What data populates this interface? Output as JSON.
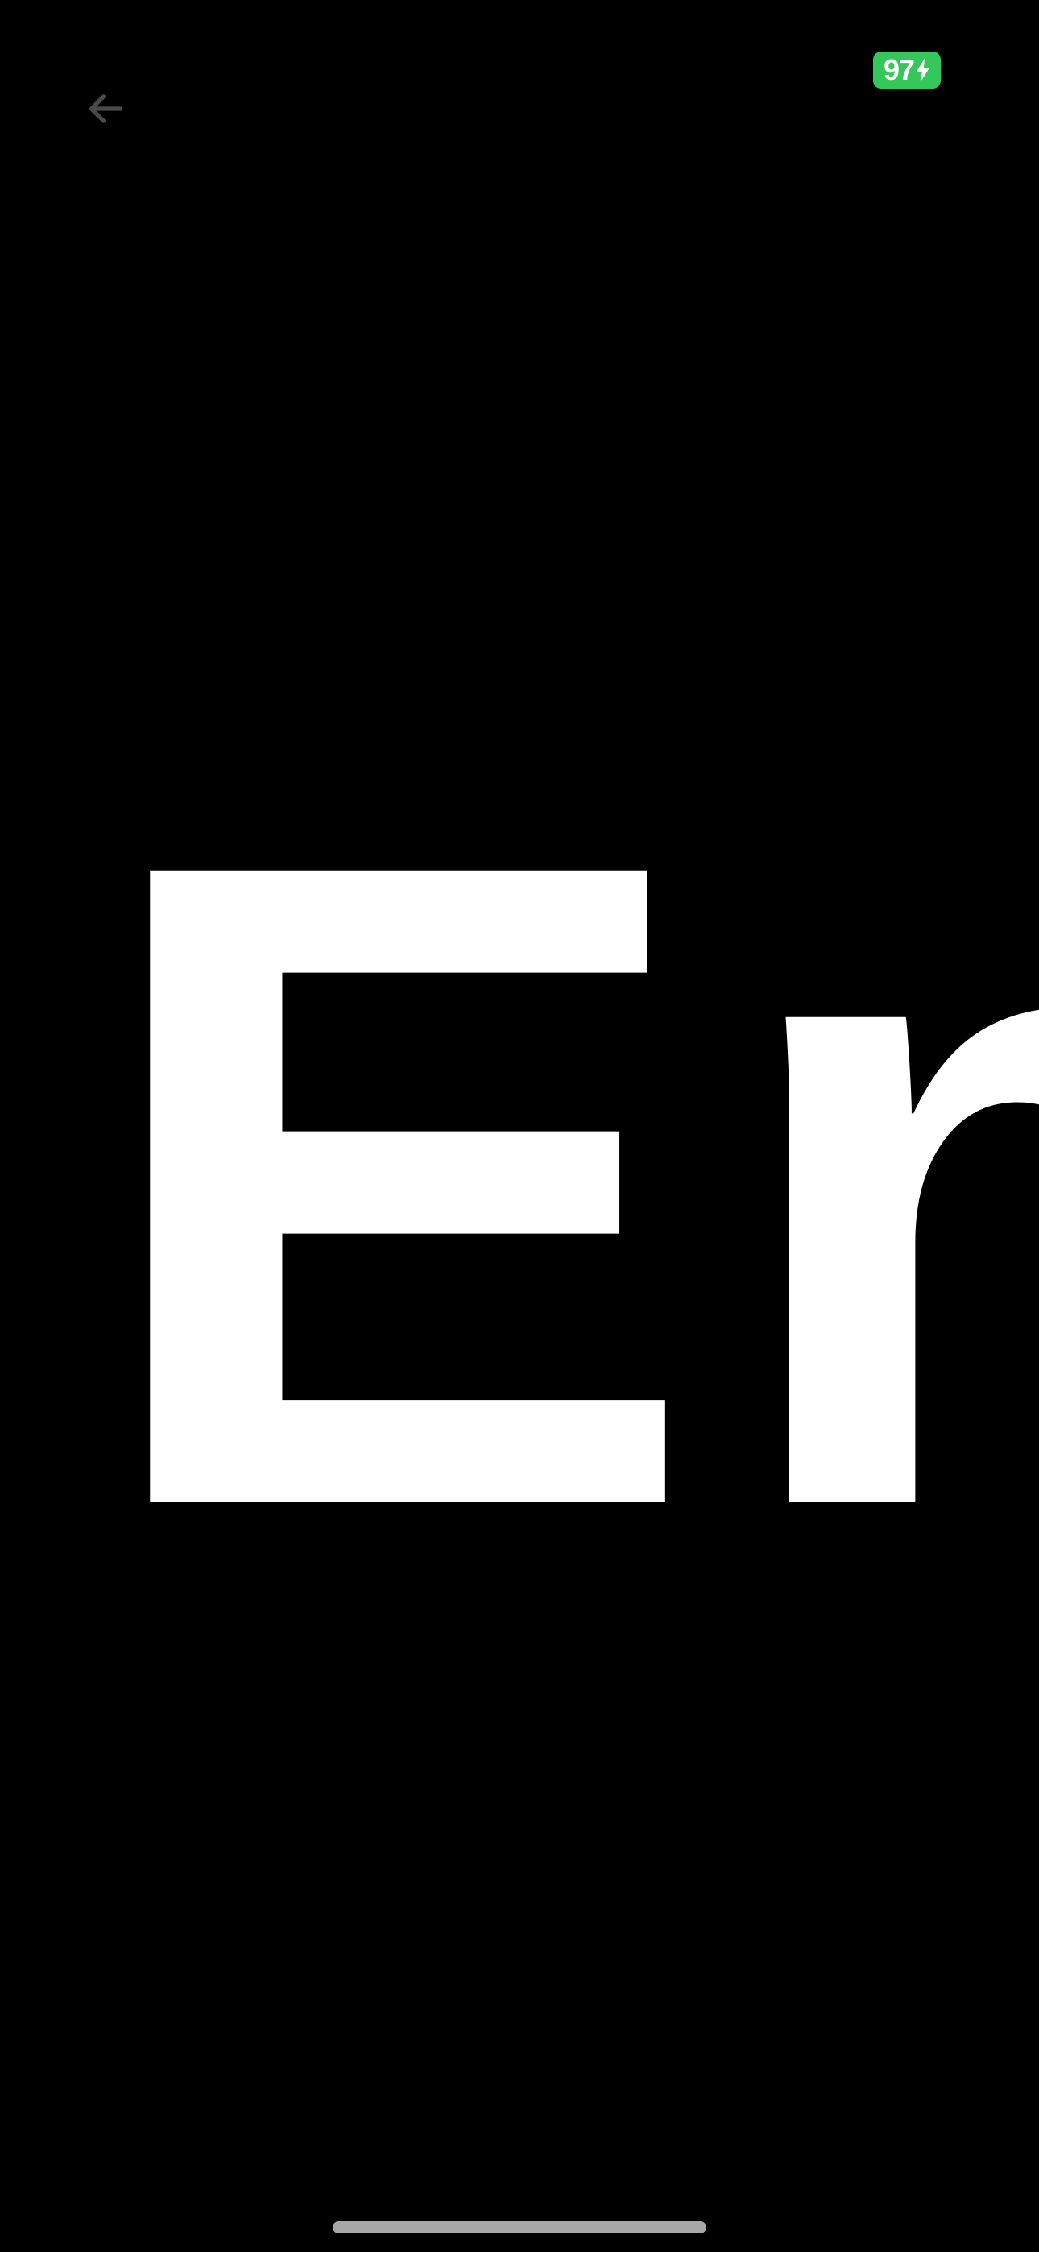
{
  "status_bar": {
    "battery_level": "97",
    "battery_color": "#34c759",
    "battery_state_icon": "charging-bolt-icon"
  },
  "toolbar": {
    "back_icon": "arrow-left-icon"
  },
  "display": {
    "text": "En",
    "background_color": "#000000",
    "text_color": "#ffffff"
  }
}
